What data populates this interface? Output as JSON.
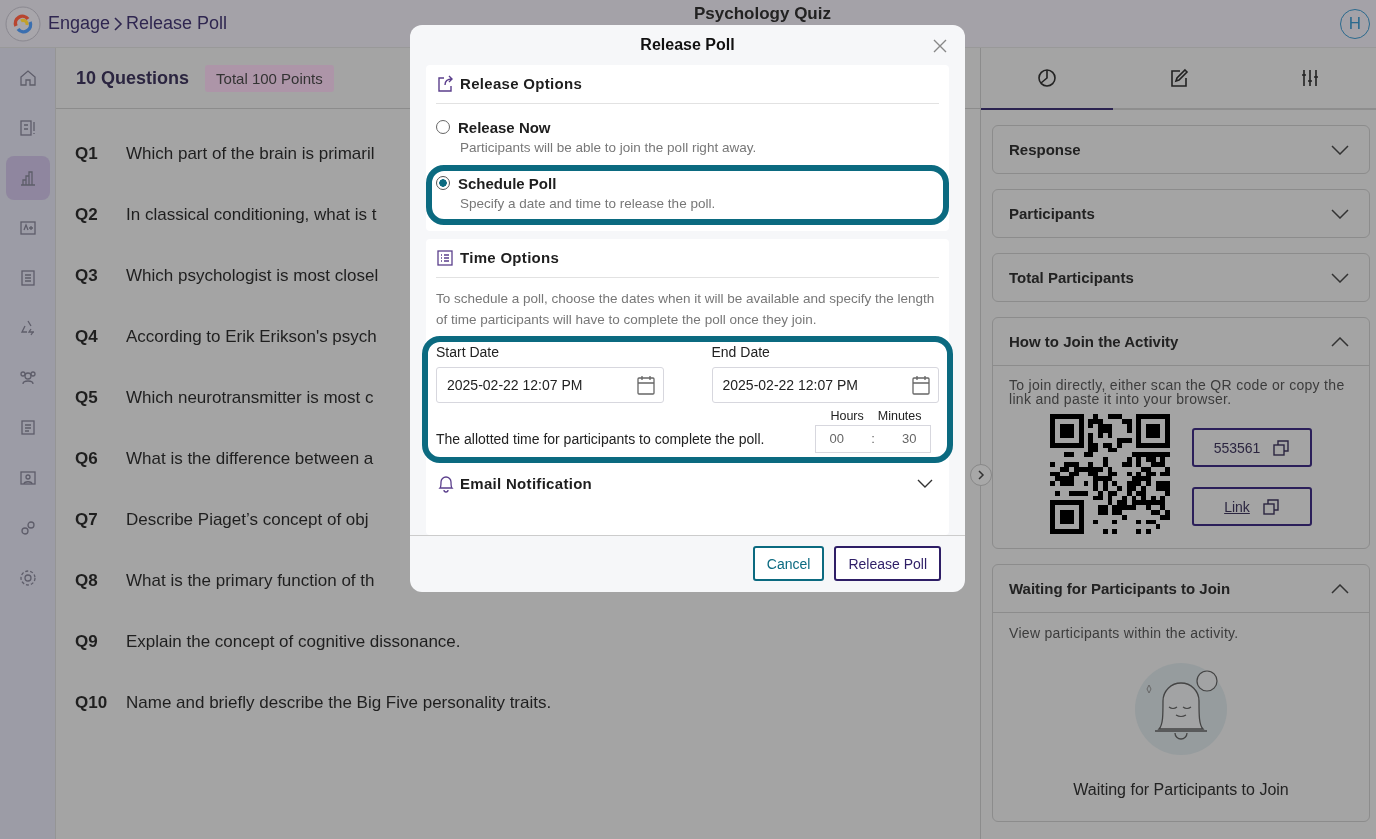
{
  "app": {
    "breadcrumb": [
      "Engage",
      "Release Poll"
    ],
    "title": "Psychology Quiz",
    "avatar": "H"
  },
  "sidebar": {
    "items": [
      {
        "selected": false
      },
      {
        "selected": false
      },
      {
        "selected": true
      },
      {
        "selected": false
      },
      {
        "selected": false
      },
      {
        "selected": false
      },
      {
        "selected": false
      },
      {
        "selected": false
      },
      {
        "selected": false
      },
      {
        "selected": false
      },
      {
        "selected": false
      }
    ]
  },
  "quiz": {
    "heading": "10 Questions",
    "points": "Total 100 Points",
    "questions": [
      {
        "number": "Q1",
        "text": "Which part of the brain is primaril"
      },
      {
        "number": "Q2",
        "text": "In classical conditioning, what is t"
      },
      {
        "number": "Q3",
        "text": "Which psychologist is most closel"
      },
      {
        "number": "Q4",
        "text": "According to Erik Erikson's psych"
      },
      {
        "number": "Q5",
        "text": "Which neurotransmitter is most c"
      },
      {
        "number": "Q6",
        "text": "What is the difference between a"
      },
      {
        "number": "Q7",
        "text": "Describe Piaget’s concept of obj"
      },
      {
        "number": "Q8",
        "text": "What is the primary function of th"
      },
      {
        "number": "Q9",
        "text": "Explain the concept of cognitive dissonance."
      },
      {
        "number": "Q10",
        "text": "Name and briefly describe the Big Five personality traits."
      }
    ]
  },
  "panel": {
    "tabs": [
      {
        "selected": true
      },
      {
        "selected": false
      },
      {
        "selected": false
      }
    ],
    "sections": [
      {
        "title": "Response",
        "expanded": false
      },
      {
        "title": "Participants",
        "expanded": false
      },
      {
        "title": "Total Participants",
        "expanded": false
      },
      {
        "kind": "join",
        "title": "How to Join the Activity",
        "expanded": true,
        "hint": "To join directly, either scan the QR code or copy the link and paste it into your browser.",
        "code": "553561",
        "link": "Link"
      },
      {
        "kind": "waiting",
        "title": "Waiting for Participants to Join",
        "expanded": true,
        "hint": "View participants within the activity.",
        "message": "Waiting for Participants to Join"
      }
    ]
  },
  "modal": {
    "title": "Release Poll",
    "release_options": {
      "title": "Release Options",
      "options": [
        {
          "label": "Release Now",
          "description": "Participants will be able to join the poll right away.",
          "selected": false,
          "highlighted": false
        },
        {
          "label": "Schedule Poll",
          "description": "Specify a date and time to release the poll.",
          "selected": true,
          "highlighted": true
        }
      ]
    },
    "time_options": {
      "title": "Time Options",
      "description": "To schedule a poll, choose the dates when it will be available and specify the length of time participants will have to complete the poll once they join.",
      "highlighted": true,
      "start_date": {
        "label": "Start Date",
        "value": "2025-02-22 12:07 PM"
      },
      "end_date": {
        "label": "End Date",
        "value": "2025-02-22 12:07 PM"
      },
      "duration": {
        "text": "The allotted time for participants to complete the poll.",
        "hours_label": "Hours",
        "minutes_label": "Minutes",
        "hours": "00",
        "separator": ":",
        "minutes": "30"
      }
    },
    "email_notification": {
      "title": "Email Notification",
      "expanded": false
    },
    "buttons": {
      "cancel": "Cancel",
      "confirm": "Release Poll"
    }
  }
}
